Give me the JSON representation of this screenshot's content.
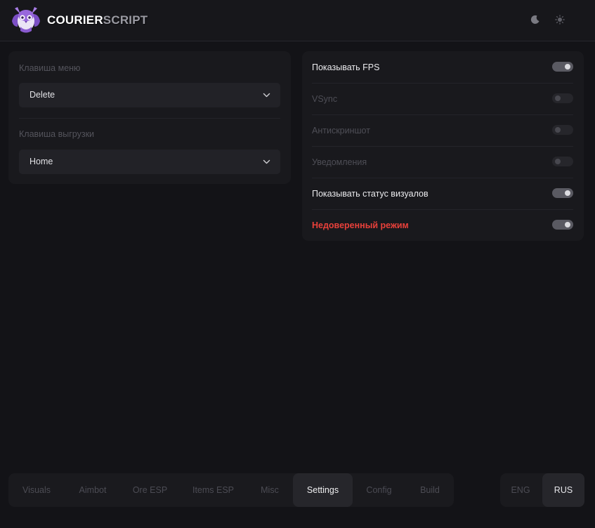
{
  "brand": {
    "name_primary": "COURIER",
    "name_secondary": "SCRIPT"
  },
  "header": {
    "icons": [
      "moon-icon",
      "sun-icon"
    ]
  },
  "keybinds": {
    "menu_key": {
      "label": "Клавиша меню",
      "value": "Delete"
    },
    "unload_key": {
      "label": "Клавиша выгрузки",
      "value": "Home"
    }
  },
  "options": [
    {
      "label": "Показывать FPS",
      "enabled": true
    },
    {
      "label": "VSync",
      "enabled": false
    },
    {
      "label": "Антискриншот",
      "enabled": false
    },
    {
      "label": "Уведомления",
      "enabled": false
    },
    {
      "label": "Показывать статус визуалов",
      "enabled": true
    },
    {
      "label": "Недоверенный режим",
      "enabled": true,
      "danger": true
    }
  ],
  "tabs": [
    {
      "label": "Visuals"
    },
    {
      "label": "Aimbot"
    },
    {
      "label": "Ore ESP"
    },
    {
      "label": "Items ESP"
    },
    {
      "label": "Misc"
    },
    {
      "label": "Settings",
      "active": true
    },
    {
      "label": "Config"
    },
    {
      "label": "Build"
    }
  ],
  "languages": [
    {
      "label": "ENG"
    },
    {
      "label": "RUS",
      "active": true
    }
  ],
  "colors": {
    "background": "#131317",
    "panel": "#19191d",
    "danger": "#e8403a",
    "logo": "#8e5bd6"
  }
}
